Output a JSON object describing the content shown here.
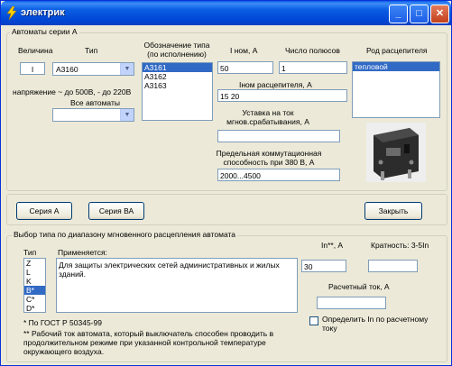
{
  "window": {
    "title": "электрик",
    "colors": {
      "titlebar": "#0054e3",
      "selection": "#316ac5",
      "face": "#ece9d8"
    }
  },
  "group_a": {
    "legend": "Автоматы серии А",
    "velichina_label": "Величина",
    "velichina_value": "I",
    "type_label": "Тип",
    "type_value": "А3160",
    "voltage_label": "напряжение ~ до 500В, - до 220В",
    "all_label": "Все автоматы",
    "all_value": "",
    "designation_label": "Обозначение типа (по исполнению)",
    "designations": [
      "А3161",
      "А3162",
      "А3163"
    ],
    "designation_selected": 0,
    "inom_label": "I ном, А",
    "inom_value": "50",
    "poles_label": "Число полюсов",
    "poles_value": "1",
    "release_label": "Род расцепителя",
    "releases": [
      "тепловой"
    ],
    "release_selected": 0,
    "inom_release_label": "Iном расцепителя, А",
    "inom_release_value": "15 20",
    "setting_label": "Уставка на ток мгнов.срабатывания, А",
    "setting_value": "",
    "breaking_label": "Предельная коммутационная способность при 380 В, А",
    "breaking_value": "2000...4500",
    "device_image": "circuit-breaker-photo"
  },
  "buttons": {
    "series_a": "Серия А",
    "series_va": "Серия ВА",
    "close": "Закрыть"
  },
  "group_b": {
    "legend": "Выбор типа по диапазону мгновенного расцепления автомата",
    "type_label": "Тип",
    "types": [
      "Z",
      "L",
      "K",
      "B*",
      "C*",
      "D*"
    ],
    "type_selected": 3,
    "applied_label": "Применяется:",
    "applied_text": "Для защиты электрических сетей административных и жилых зданий.",
    "in_label": "In**, А",
    "in_value": "30",
    "ratio_label": "Кратность: 3-5In",
    "ratio_value": "",
    "calc_label": "Расчетный ток, А",
    "calc_value": "",
    "footnote1": "* По ГОСТ Р 50345-99",
    "footnote2": "** Рабочий ток автомата, который выключатель способен проводить в продолжительном режиме  при указанной контрольной температуре окружающего воздуха.",
    "determine_label": "Определить In по расчетному току",
    "determine_checked": false
  }
}
